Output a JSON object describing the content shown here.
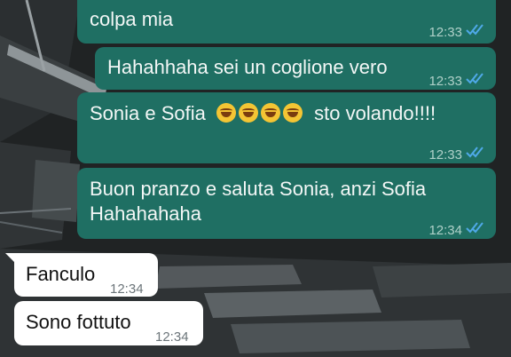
{
  "messages": [
    {
      "side": "out",
      "text": "colpa mia",
      "time": "12:33",
      "status": "read"
    },
    {
      "side": "out",
      "text": "Hahahhaha sei un coglione vero",
      "time": "12:33",
      "status": "read"
    },
    {
      "side": "out",
      "text_before": "Sonia e Sofia",
      "emoji": [
        "rolling-laughing",
        "rolling-laughing",
        "rolling-laughing",
        "rolling-laughing"
      ],
      "text_after": "sto volando!!!!",
      "time": "12:33",
      "status": "read"
    },
    {
      "side": "out",
      "line1": "Buon pranzo e saluta Sonia, anzi Sofia",
      "line2": "Hahahahaha",
      "time": "12:34",
      "status": "read"
    },
    {
      "side": "in",
      "text": "Fanculo",
      "time": "12:34"
    },
    {
      "side": "in",
      "text": "Sono fottuto",
      "time": "12:34"
    }
  ],
  "colors": {
    "outgoing_bubble": "#1f6f63",
    "incoming_bubble": "#ffffff",
    "read_ticks": "#4fa9e8",
    "wallpaper": "#1c1f20"
  }
}
